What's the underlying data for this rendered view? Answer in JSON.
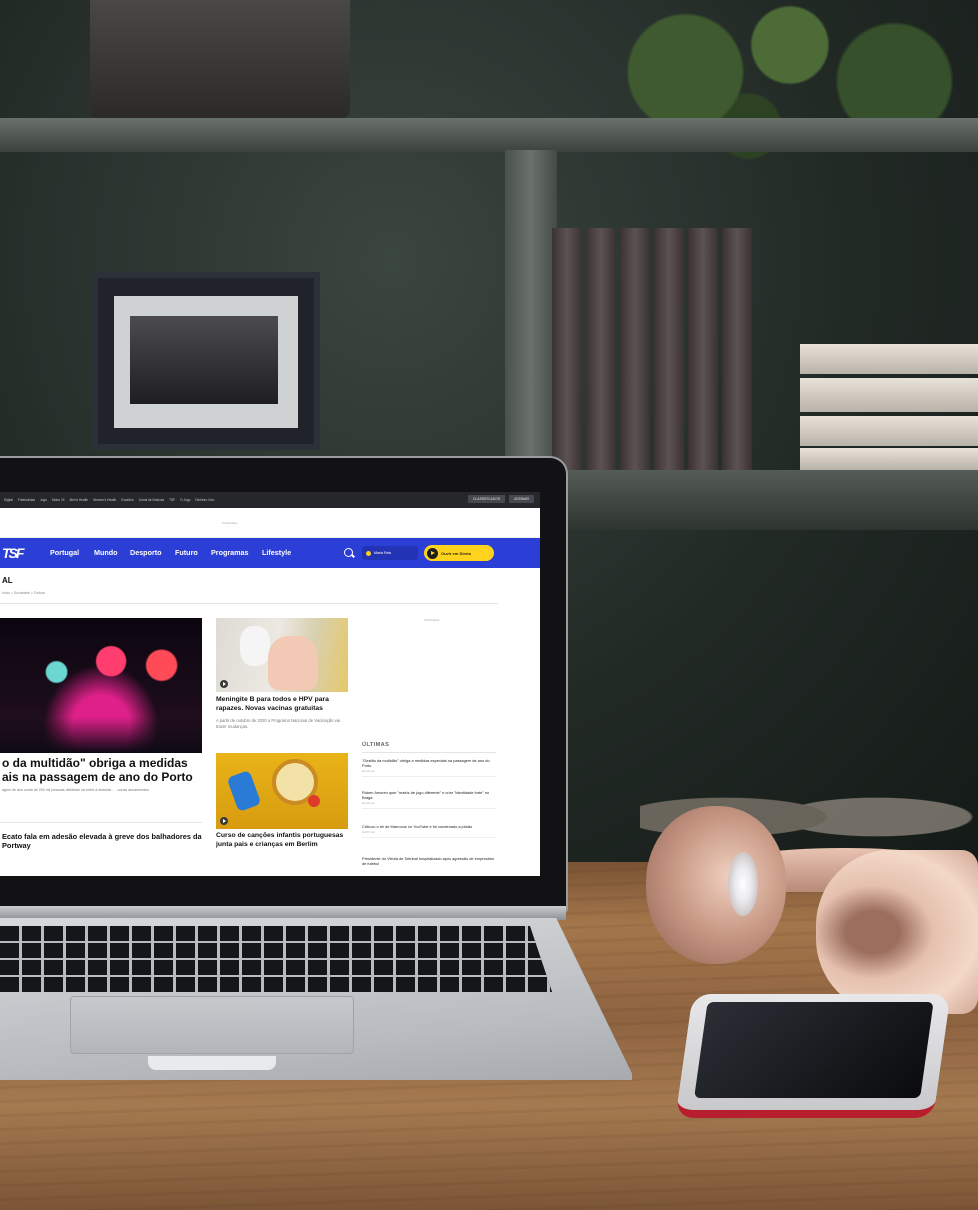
{
  "website": {
    "topbar": {
      "links": [
        "Digital",
        "Futebolistas",
        "Jogo",
        "Motor 24",
        "Men's Health",
        "Women's Health",
        "Evasões",
        "Jornal de Notícias",
        "TSF",
        "O Jogo",
        "Dinheiro Vivo"
      ],
      "buttons": [
        "CLASSIFICADOS",
        "ASSINAR"
      ]
    },
    "ad_label": "Publicidade",
    "nav": {
      "logo": "TSF",
      "items": [
        "Portugal",
        "Mundo",
        "Desporto",
        "Futuro",
        "Programas",
        "Lifestyle"
      ],
      "user": "Maria Reis",
      "live_label": "Ouvir em Direto"
    },
    "section": {
      "title": "AL",
      "breadcrumbs": "Início > Sociedade > Cultura"
    },
    "hero": {
      "title": "o da multidão\" obriga a medidas ais na passagem de ano do Porto",
      "lead": "agem de ano conta de 200 mil pessoas dividiram na entre a Avenida …, conas anualmentes."
    },
    "story2": "Ecato fala em adesão elevada à greve dos balhadores da Portway",
    "cards": [
      {
        "title": "Meningite B para todos e HPV para rapazes. Novas vacinas gratuitas",
        "lead": "A partir de outubro de 2020 o Programa Nacional de Vacinação vai trazer mudanças."
      },
      {
        "title": "Curso de canções infantis portuguesas junta pais e crianças em Berlim",
        "lead": ""
      }
    ],
    "sidebar": {
      "ad_label": "Publicidade",
      "latest_heading": "ÚLTIMAS",
      "latest": [
        {
          "title": "\"Gestão da multidão\" obriga a medidas especiais na passagem de ano do Porto",
          "time": "Há 10 min"
        },
        {
          "title": "Rúben Amorim quer \"matriz de jogo diferente\" e criar \"identidade forte\" no Braga",
          "time": "Há 30 min"
        },
        {
          "title": "Critícou o rei de Marrocos no YouTube e foi condenado a prisão",
          "time": "Há 57 min"
        },
        {
          "title": "Presidente do Vitória de Setúbal hospitalizado após agressão de empresário de futebol",
          "time": ""
        }
      ]
    }
  },
  "colors": {
    "nav_blue": "#2b3fd6",
    "live_yellow": "#ffd21e",
    "topbar_dark": "#25272b"
  }
}
